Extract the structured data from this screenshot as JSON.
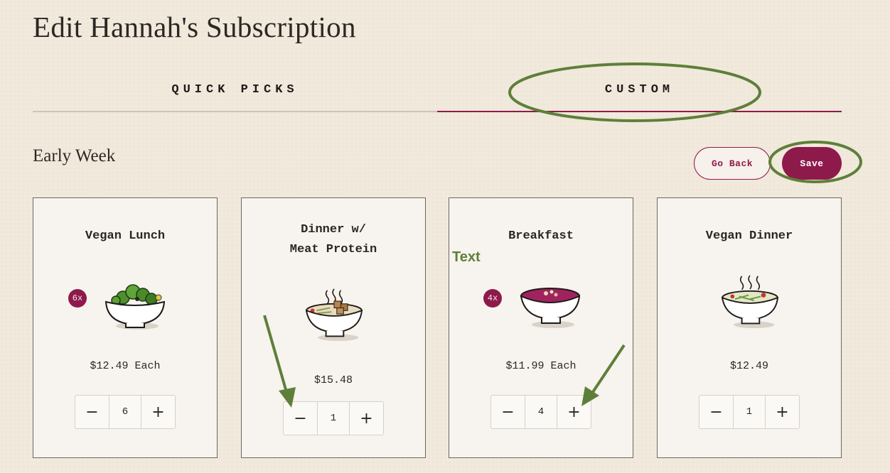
{
  "page": {
    "title": "Edit Hannah's Subscription"
  },
  "tabs": [
    {
      "label": "QUICK PICKS",
      "active": false
    },
    {
      "label": "CUSTOM",
      "active": true
    }
  ],
  "section": {
    "title": "Early Week",
    "back_label": "Go Back",
    "save_label": "Save"
  },
  "cards": [
    {
      "title": "Vegan Lunch",
      "badge": "6x",
      "price": "$12.49 Each",
      "quantity": "6",
      "image": "salad-bowl-icon"
    },
    {
      "title": "Dinner w/ Meat Protein",
      "title_line1": "Dinner w/",
      "title_line2": "Meat Protein",
      "badge": "",
      "price": "$15.48",
      "quantity": "1",
      "image": "meat-soup-bowl-icon"
    },
    {
      "title": "Breakfast",
      "badge": "4x",
      "price": "$11.99 Each",
      "quantity": "4",
      "image": "smoothie-bowl-icon"
    },
    {
      "title": "Vegan Dinner",
      "badge": "",
      "price": "$12.49",
      "quantity": "1",
      "image": "veggie-soup-bowl-icon"
    }
  ],
  "stepper": {
    "minus_symbol": "−",
    "plus_symbol": "+"
  },
  "annotations": {
    "text_label": "Text",
    "color": "#5e7f3a"
  },
  "colors": {
    "accent": "#8e1a4b",
    "background": "#f1e9dc"
  }
}
